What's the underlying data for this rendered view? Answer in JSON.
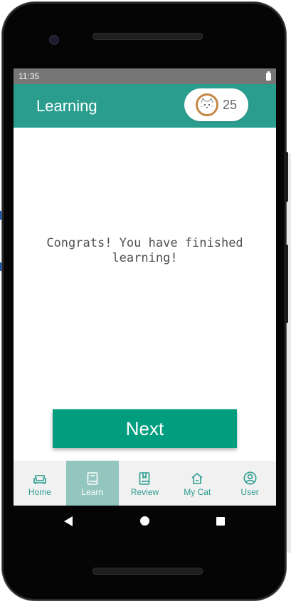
{
  "status_bar": {
    "time": "11:35"
  },
  "app_bar": {
    "title": "Learning",
    "coins": "25"
  },
  "content": {
    "line1": "Congrats! You have finished",
    "line2": "learning!",
    "next_label": "Next"
  },
  "bottom_nav": {
    "items": [
      {
        "label": "Home",
        "icon": "sofa-icon"
      },
      {
        "label": "Learn",
        "icon": "book-icon",
        "active": true
      },
      {
        "label": "Review",
        "icon": "bookmark-book-icon"
      },
      {
        "label": "My Cat",
        "icon": "house-icon"
      },
      {
        "label": "User",
        "icon": "user-circle-icon"
      }
    ]
  },
  "colors": {
    "app_bar": "#2a9d8f",
    "next_button": "#009e7f",
    "nav_active_bg": "#93c6be",
    "nav_text": "#2a9d8f"
  }
}
